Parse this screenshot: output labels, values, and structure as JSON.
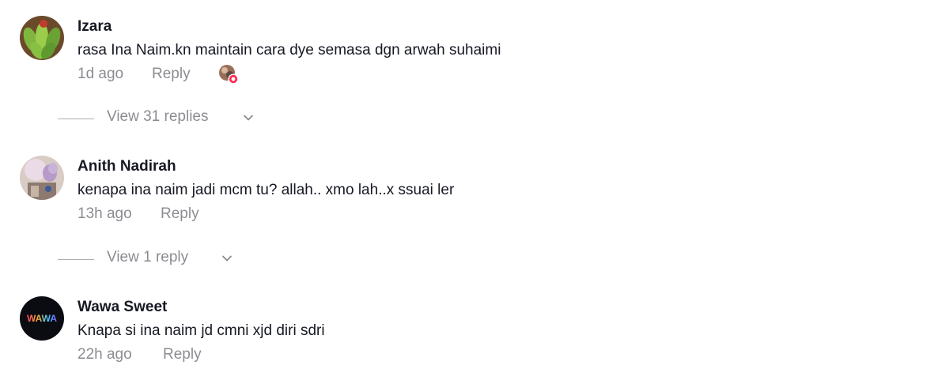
{
  "comments": [
    {
      "username": "Izara",
      "text": "rasa Ina Naim.kn maintain cara dye semasa dgn arwah suhaimi",
      "time": "1d ago",
      "reply_label": "Reply",
      "avatar_icon": "avatar-green-fruit",
      "has_creator_like": true,
      "view_replies_label": "View 31 replies"
    },
    {
      "username": "Anith Nadirah",
      "text": "kenapa ina naim jadi mcm tu? allah.. xmo lah..x ssuai ler",
      "time": "13h ago",
      "reply_label": "Reply",
      "avatar_icon": "avatar-pastel-photo",
      "view_replies_label": "View 1 reply"
    },
    {
      "username": "Wawa Sweet",
      "text": "Knapa si ina naim jd cmni xjd diri sdri",
      "time": "22h ago",
      "reply_label": "Reply",
      "avatar_icon": "avatar-wawa-logo",
      "avatar_text": "WAWA"
    }
  ],
  "colors": {
    "primary_text": "#161823",
    "secondary_text": "rgba(22,24,35,0.5)",
    "like_badge": "#fe2c55"
  }
}
